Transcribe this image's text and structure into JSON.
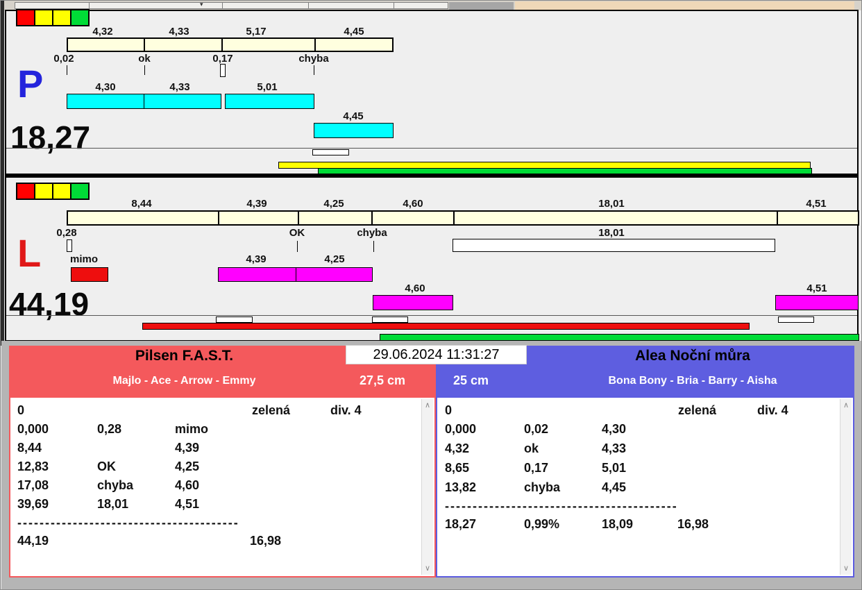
{
  "clock": {
    "datetime": "29.06.2024 11:31:27"
  },
  "colors": {
    "window_bg": "#EDEDED",
    "cream_bar": "#FFFFDF",
    "cyan_bar": "#00FFFF",
    "magenta_bar": "#FF00FF",
    "red_bar": "#EE0E0E",
    "yellow_bar": "#FFFF00",
    "green_bar": "#00DC37",
    "team_left": "#F4595C",
    "team_right": "#5E5EE0",
    "lane_p_letter": "#2424DC",
    "lane_l_letter": "#E01818",
    "toolbar_tan": "#EFD8B8"
  },
  "lane_p": {
    "letter": "P",
    "total": "18,27",
    "lights": [
      "#FF0000",
      "#FFFF00",
      "#FFFF00",
      "#00DC37"
    ],
    "ideal_splits": [
      "4,32",
      "4,33",
      "5,17",
      "4,45"
    ],
    "marks": [
      "0,02",
      "ok",
      "0,17",
      "chyba"
    ],
    "run_splits": [
      "4,30",
      "4,33",
      "5,01",
      "4,45"
    ]
  },
  "lane_l": {
    "letter": "L",
    "total": "44,19",
    "lights": [
      "#FF0000",
      "#FFFF00",
      "#FFFF00",
      "#00DC37"
    ],
    "ideal_splits": [
      "8,44",
      "4,39",
      "4,25",
      "4,60",
      "18,01",
      "4,51"
    ],
    "marks": [
      "0,28",
      "OK",
      "chyba",
      "18,01"
    ],
    "mimo": "mimo",
    "long_split": "18,01",
    "run_splits": [
      "4,39",
      "4,25",
      "4,60",
      "4,51"
    ]
  },
  "team_left": {
    "name": "Pilsen F.A.S.T.",
    "dogs": "Majlo - Ace - Arrow - Emmy",
    "height": "27,5 cm",
    "result": {
      "start": "0",
      "lane_color": "zelená",
      "division": "div. 4",
      "rows": [
        [
          "0,000",
          "0,28",
          "mimo"
        ],
        [
          "8,44",
          "",
          "4,39"
        ],
        [
          "12,83",
          "OK",
          "4,25"
        ],
        [
          "17,08",
          "chyba",
          "4,60"
        ],
        [
          "39,69",
          "18,01",
          "4,51"
        ]
      ],
      "dashes": "----------------------------------------",
      "total_time": "44,19",
      "best_possible": "16,98"
    }
  },
  "team_right": {
    "name": "Alea Noční můra",
    "dogs": "Bona Bony - Bria - Barry - Aisha",
    "height": "25 cm",
    "result": {
      "start": "0",
      "lane_color": "zelená",
      "division": "div. 4",
      "rows": [
        [
          "0,000",
          "0,02",
          "4,30"
        ],
        [
          "4,32",
          "ok",
          "4,33"
        ],
        [
          "8,65",
          "0,17",
          "5,01"
        ],
        [
          "13,82",
          "chyba",
          "4,45"
        ]
      ],
      "dashes": "------------------------------------------",
      "totals": [
        "18,27",
        "0,99%",
        "18,09",
        "16,98"
      ]
    }
  },
  "scrollbar": {
    "up_icon": "∧",
    "down_icon": "∨"
  },
  "toolbar": {
    "caret_icon": "▾"
  }
}
